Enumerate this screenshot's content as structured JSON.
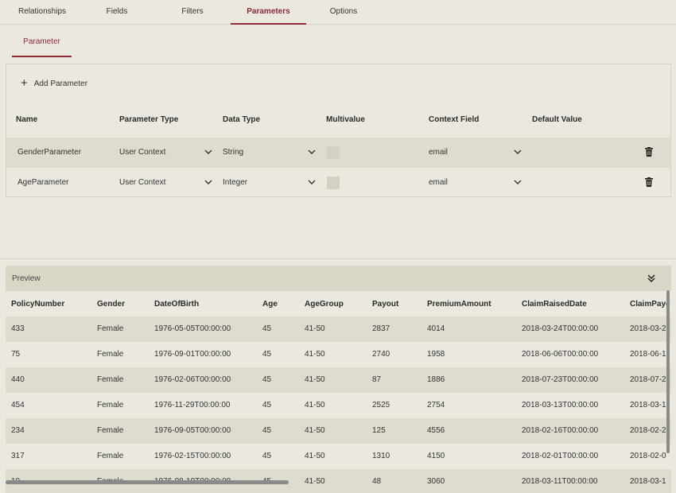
{
  "tabs": [
    {
      "label": "Relationships",
      "active": false
    },
    {
      "label": "Fields",
      "active": false
    },
    {
      "label": "Filters",
      "active": false
    },
    {
      "label": "Parameters",
      "active": true
    },
    {
      "label": "Options",
      "active": false
    }
  ],
  "subtab": {
    "label": "Parameter"
  },
  "add_parameter": {
    "label": "Add Parameter",
    "icon": "plus-icon"
  },
  "param_headers": {
    "name": "Name",
    "parameter_type": "Parameter Type",
    "data_type": "Data Type",
    "multivalue": "Multivalue",
    "context_field": "Context Field",
    "default_value": "Default Value"
  },
  "parameters": [
    {
      "name": "GenderParameter",
      "parameter_type": "User Context",
      "data_type": "String",
      "multivalue": false,
      "context_field": "email",
      "default_value": ""
    },
    {
      "name": "AgeParameter",
      "parameter_type": "User Context",
      "data_type": "Integer",
      "multivalue": false,
      "context_field": "email",
      "default_value": ""
    }
  ],
  "preview": {
    "title": "Preview",
    "columns": [
      "PolicyNumber",
      "Gender",
      "DateOfBirth",
      "Age",
      "AgeGroup",
      "Payout",
      "PremiumAmount",
      "ClaimRaisedDate",
      "ClaimPaye"
    ],
    "rows": [
      [
        "433",
        "Female",
        "1976-05-05T00:00:00",
        "45",
        "41-50",
        "2837",
        "4014",
        "2018-03-24T00:00:00",
        "2018-03-2"
      ],
      [
        "75",
        "Female",
        "1976-09-01T00:00:00",
        "45",
        "41-50",
        "2740",
        "1958",
        "2018-06-06T00:00:00",
        "2018-06-1"
      ],
      [
        "440",
        "Female",
        "1976-02-06T00:00:00",
        "45",
        "41-50",
        "87",
        "1886",
        "2018-07-23T00:00:00",
        "2018-07-2"
      ],
      [
        "454",
        "Female",
        "1976-11-29T00:00:00",
        "45",
        "41-50",
        "2525",
        "2754",
        "2018-03-13T00:00:00",
        "2018-03-1"
      ],
      [
        "234",
        "Female",
        "1976-09-05T00:00:00",
        "45",
        "41-50",
        "125",
        "4556",
        "2018-02-16T00:00:00",
        "2018-02-2"
      ],
      [
        "317",
        "Female",
        "1976-02-15T00:00:00",
        "45",
        "41-50",
        "1310",
        "4150",
        "2018-02-01T00:00:00",
        "2018-02-0"
      ],
      [
        "19",
        "Female",
        "1976-08-19T00:00:00",
        "45",
        "41-50",
        "48",
        "3060",
        "2018-03-11T00:00:00",
        "2018-03-1"
      ]
    ]
  },
  "colors": {
    "accent": "#8e2a38",
    "background": "#ebe8e0",
    "row_alt": "#dedbcf",
    "preview_header": "#d9d6c6"
  }
}
